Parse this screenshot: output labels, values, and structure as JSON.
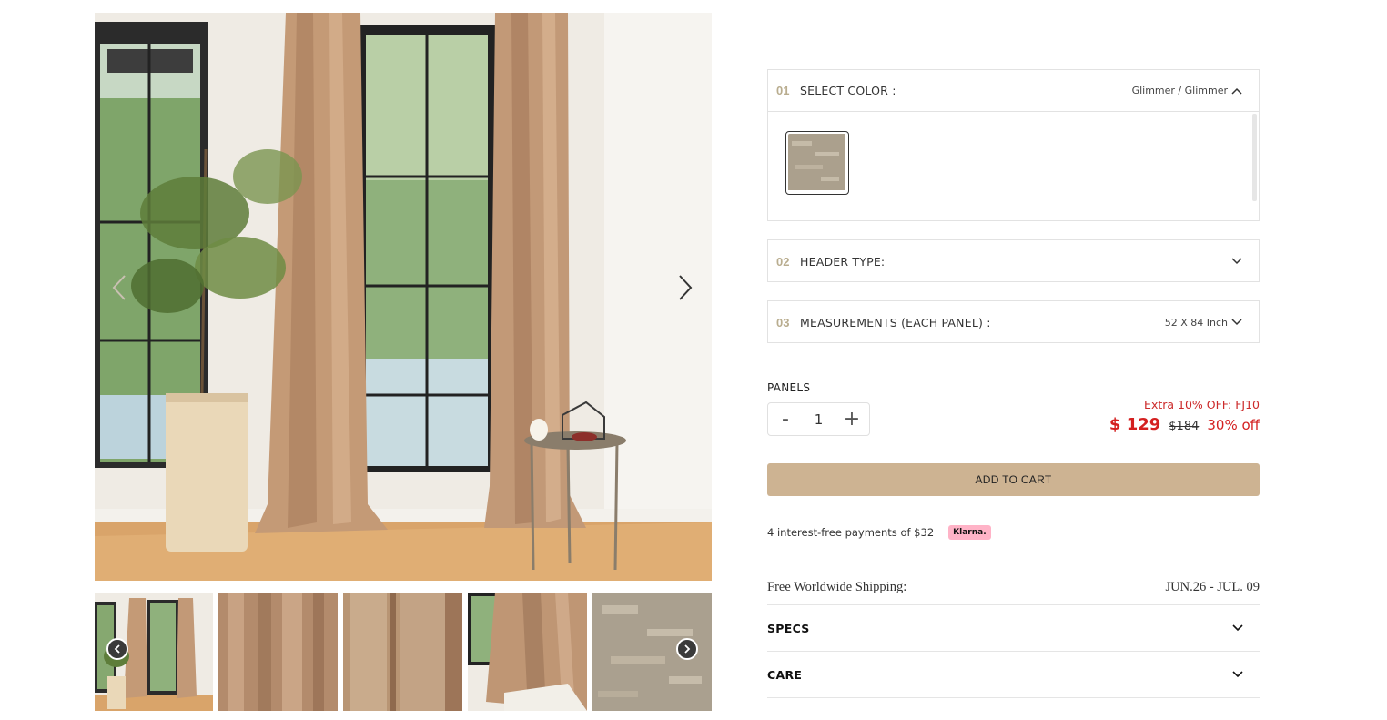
{
  "gallery": {
    "main_alt": "Beige velvet curtains by large window",
    "prev_icon": "chevron-left-icon",
    "next_icon": "chevron-right-icon",
    "thumbnail_count": 5
  },
  "options": [
    {
      "number": "01",
      "title": "SELECT COLOR :",
      "value": "Glimmer / Glimmer",
      "icon": "chevron-up-icon",
      "expanded": true
    },
    {
      "number": "02",
      "title": "HEADER TYPE:",
      "value": "",
      "icon": "chevron-down-icon",
      "expanded": false
    },
    {
      "number": "03",
      "title": "MEASUREMENTS (EACH PANEL) :",
      "value": "52 X 84 Inch",
      "icon": "chevron-down-icon",
      "expanded": false
    }
  ],
  "quantity": {
    "label": "PANELS",
    "value": "1",
    "minus": "-",
    "plus": "+"
  },
  "price": {
    "promo": "Extra 10% OFF: FJ10",
    "current": "$ 129",
    "original": "$184",
    "discount": "30% off",
    "accent_color": "#d42020"
  },
  "cart": {
    "label": "ADD TO CART",
    "color": "#cdb392"
  },
  "payment": {
    "text": "4 interest-free payments of $32",
    "badge": "Klarna."
  },
  "shipping": {
    "label": "Free Worldwide Shipping:",
    "dates": "JUN.26 - JUL. 09"
  },
  "accordions": [
    {
      "title": "SPECS",
      "icon": "chevron-down-icon"
    },
    {
      "title": "CARE",
      "icon": "chevron-down-icon"
    }
  ]
}
